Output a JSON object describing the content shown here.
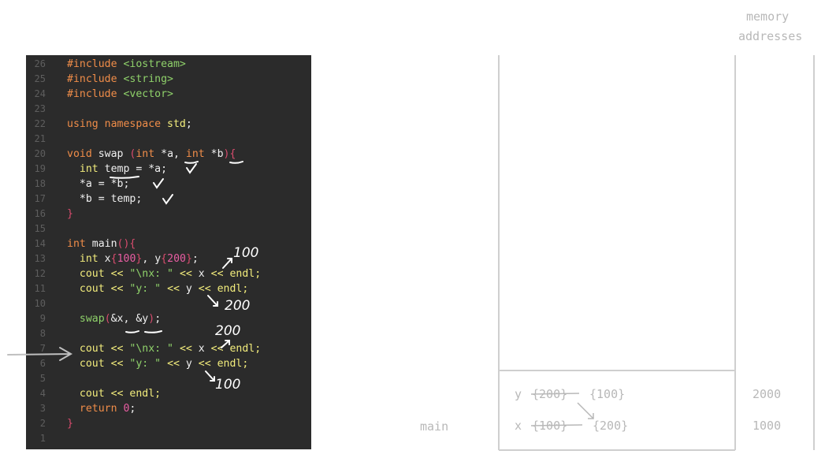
{
  "code_lines": [
    {
      "ln": "26",
      "tokens": [
        {
          "c": "kw",
          "t": "#include "
        },
        {
          "c": "str",
          "t": "<iostream>"
        }
      ]
    },
    {
      "ln": "25",
      "tokens": [
        {
          "c": "kw",
          "t": "#include "
        },
        {
          "c": "str",
          "t": "<string>"
        }
      ]
    },
    {
      "ln": "24",
      "tokens": [
        {
          "c": "kw",
          "t": "#include "
        },
        {
          "c": "str",
          "t": "<vector>"
        }
      ]
    },
    {
      "ln": "23",
      "tokens": []
    },
    {
      "ln": "22",
      "tokens": [
        {
          "c": "kw",
          "t": "using namespace "
        },
        {
          "c": "op",
          "t": "std"
        },
        {
          "c": "plain",
          "t": ";"
        }
      ]
    },
    {
      "ln": "21",
      "tokens": []
    },
    {
      "ln": "20",
      "tokens": [
        {
          "c": "kw",
          "t": "void "
        },
        {
          "c": "plain",
          "t": "swap "
        },
        {
          "c": "paren",
          "t": "("
        },
        {
          "c": "kw",
          "t": "int "
        },
        {
          "c": "plain",
          "t": "*a, "
        },
        {
          "c": "kw",
          "t": "int "
        },
        {
          "c": "plain",
          "t": "*b"
        },
        {
          "c": "paren",
          "t": "){"
        }
      ]
    },
    {
      "ln": "19",
      "tokens": [
        {
          "c": "plain",
          "t": "  "
        },
        {
          "c": "op",
          "t": "int "
        },
        {
          "c": "plain",
          "t": "temp = *a;"
        }
      ]
    },
    {
      "ln": "18",
      "tokens": [
        {
          "c": "plain",
          "t": "  *a = *b;"
        }
      ]
    },
    {
      "ln": "17",
      "tokens": [
        {
          "c": "plain",
          "t": "  *b = temp;"
        }
      ]
    },
    {
      "ln": "16",
      "tokens": [
        {
          "c": "paren",
          "t": "}"
        }
      ]
    },
    {
      "ln": "15",
      "tokens": []
    },
    {
      "ln": "14",
      "tokens": [
        {
          "c": "kw",
          "t": "int "
        },
        {
          "c": "plain",
          "t": "main"
        },
        {
          "c": "paren",
          "t": "(){"
        }
      ]
    },
    {
      "ln": "13",
      "tokens": [
        {
          "c": "plain",
          "t": "  "
        },
        {
          "c": "op",
          "t": "int "
        },
        {
          "c": "plain",
          "t": "x"
        },
        {
          "c": "paren",
          "t": "{"
        },
        {
          "c": "num",
          "t": "100"
        },
        {
          "c": "paren",
          "t": "}"
        },
        {
          "c": "plain",
          "t": ", y"
        },
        {
          "c": "paren",
          "t": "{"
        },
        {
          "c": "num",
          "t": "200"
        },
        {
          "c": "paren",
          "t": "}"
        },
        {
          "c": "plain",
          "t": ";"
        }
      ]
    },
    {
      "ln": "12",
      "tokens": [
        {
          "c": "plain",
          "t": "  "
        },
        {
          "c": "op",
          "t": "cout "
        },
        {
          "c": "op",
          "t": "<< "
        },
        {
          "c": "str",
          "t": "\"\\nx: \" "
        },
        {
          "c": "op",
          "t": "<< "
        },
        {
          "c": "plain",
          "t": "x "
        },
        {
          "c": "op",
          "t": "<< endl;"
        }
      ]
    },
    {
      "ln": "11",
      "tokens": [
        {
          "c": "plain",
          "t": "  "
        },
        {
          "c": "op",
          "t": "cout "
        },
        {
          "c": "op",
          "t": "<< "
        },
        {
          "c": "str",
          "t": "\"y: \" "
        },
        {
          "c": "op",
          "t": "<< "
        },
        {
          "c": "plain",
          "t": "y "
        },
        {
          "c": "op",
          "t": "<< endl;"
        }
      ]
    },
    {
      "ln": "10",
      "tokens": []
    },
    {
      "ln": "9",
      "tokens": [
        {
          "c": "plain",
          "t": "  "
        },
        {
          "c": "str",
          "t": "swap"
        },
        {
          "c": "paren",
          "t": "("
        },
        {
          "c": "plain",
          "t": "&x, &y"
        },
        {
          "c": "paren",
          "t": ")"
        },
        {
          "c": "plain",
          "t": ";"
        }
      ]
    },
    {
      "ln": "8",
      "tokens": []
    },
    {
      "ln": "7",
      "tokens": [
        {
          "c": "plain",
          "t": "  "
        },
        {
          "c": "op",
          "t": "cout "
        },
        {
          "c": "op",
          "t": "<< "
        },
        {
          "c": "str",
          "t": "\"\\nx: \" "
        },
        {
          "c": "op",
          "t": "<< "
        },
        {
          "c": "plain",
          "t": "x "
        },
        {
          "c": "op",
          "t": "<< endl;"
        }
      ]
    },
    {
      "ln": "6",
      "tokens": [
        {
          "c": "plain",
          "t": "  "
        },
        {
          "c": "op",
          "t": "cout "
        },
        {
          "c": "op",
          "t": "<< "
        },
        {
          "c": "str",
          "t": "\"y: \" "
        },
        {
          "c": "op",
          "t": "<< "
        },
        {
          "c": "plain",
          "t": "y "
        },
        {
          "c": "op",
          "t": "<< endl;"
        }
      ]
    },
    {
      "ln": "5",
      "tokens": []
    },
    {
      "ln": "4",
      "tokens": [
        {
          "c": "plain",
          "t": "  "
        },
        {
          "c": "op",
          "t": "cout "
        },
        {
          "c": "op",
          "t": "<< endl;"
        }
      ]
    },
    {
      "ln": "3",
      "tokens": [
        {
          "c": "plain",
          "t": "  "
        },
        {
          "c": "kw",
          "t": "return "
        },
        {
          "c": "num",
          "t": "0"
        },
        {
          "c": "plain",
          "t": ";"
        }
      ]
    },
    {
      "ln": "2",
      "tokens": [
        {
          "c": "paren",
          "t": "}"
        }
      ]
    },
    {
      "ln": "1",
      "tokens": []
    }
  ],
  "annotations": {
    "x_before": "100",
    "y_before": "200",
    "x_after": "200",
    "y_after": "100"
  },
  "memory": {
    "header_line1": "memory",
    "header_line2": "addresses",
    "frame_label": "main",
    "row_y": {
      "name": "y",
      "old": "{200}",
      "new": "{100}",
      "address": "2000"
    },
    "row_x": {
      "name": "x",
      "old": "{100}",
      "new": "{200}",
      "address": "1000"
    }
  },
  "colors": {
    "editor_bg": "#2b2b2b",
    "keyword": "#f08d49",
    "string": "#8fd16a",
    "number": "#e95da3",
    "paren": "#d94c6e",
    "yellow": "#f2ec7c",
    "memory_gray": "#b8b8b8"
  }
}
